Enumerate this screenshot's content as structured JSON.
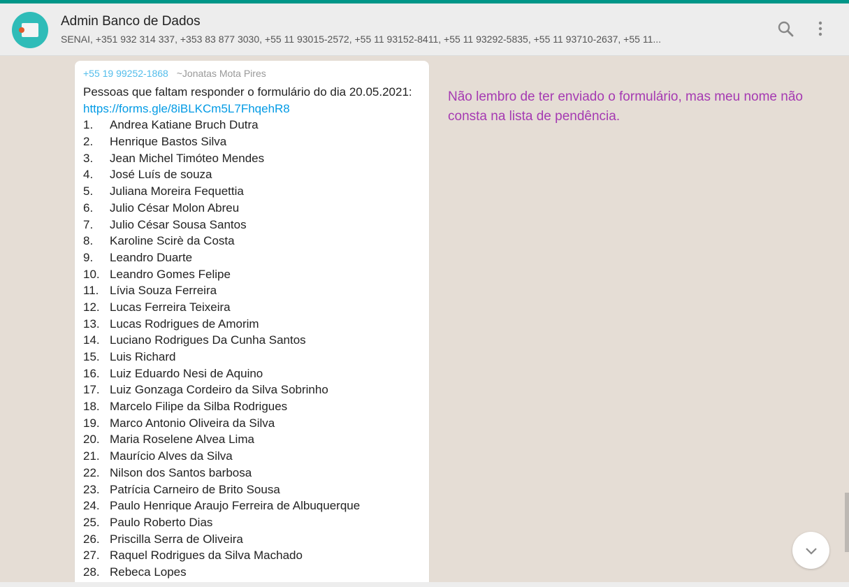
{
  "header": {
    "title": "Admin Banco de Dados",
    "subtitle": "SENAI, +351 932 314 337, +353 83 877 3030, +55 11 93015-2572, +55 11 93152-8411, +55 11 93292-5835, +55 11 93710-2637, +55 11..."
  },
  "message": {
    "sender_phone": "+55 19 99252-1868",
    "sender_name": "~Jonatas Mota Pires",
    "intro": "Pessoas que faltam responder o formulário do dia 20.05.2021:",
    "link": "https://forms.gle/8iBLKCm5L7FhqehR8",
    "items": [
      "Andrea Katiane Bruch Dutra",
      "Henrique Bastos Silva",
      "Jean Michel Timóteo Mendes",
      "José Luís de souza",
      "Juliana Moreira Fequettia",
      "Julio César Molon Abreu",
      "Julio César Sousa Santos",
      "Karoline Scirè da Costa",
      "Leandro Duarte",
      "Leandro Gomes Felipe",
      "Lívia Souza Ferreira",
      "Lucas Ferreira Teixeira",
      "Lucas Rodrigues de Amorim",
      "Luciano Rodrigues Da Cunha Santos",
      "Luis Richard",
      "Luiz Eduardo Nesi de Aquino",
      "Luiz Gonzaga Cordeiro da Silva Sobrinho",
      "Marcelo Filipe da Silba Rodrigues",
      "Marco Antonio Oliveira da Silva",
      "Maria Roselene Alvea Lima",
      "Maurício Alves da Silva",
      "Nilson dos Santos barbosa",
      "Patrícia Carneiro de Brito Sousa",
      "Paulo Henrique Araujo Ferreira de Albuquerque",
      "Paulo Roberto Dias",
      "Priscilla Serra de Oliveira",
      "Raquel Rodrigues da Silva Machado",
      "Rebeca Lopes"
    ]
  },
  "annotation": "Não lembro de ter enviado o formulário, mas meu nome não consta na lista de pendência.",
  "colors": {
    "accent": "#009688",
    "annotation": "#a53ab2",
    "link": "#039be5"
  }
}
